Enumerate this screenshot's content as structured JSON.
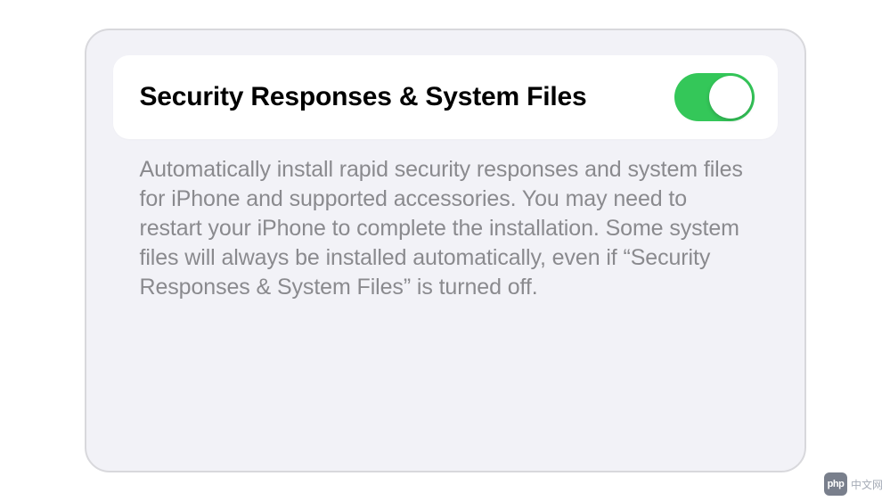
{
  "setting": {
    "title": "Security Responses & System Files",
    "toggle_on": true,
    "description": "Automatically install rapid security responses and system files for iPhone and supported accessories. You may need to restart your iPhone to complete the installation. Some system files will always be installed automatically, even if “Security Responses & System Files” is turned off."
  },
  "watermark": {
    "icon_text": "php",
    "label": "中文网"
  },
  "colors": {
    "toggle_on": "#34c759",
    "panel_bg": "#f2f2f7",
    "border": "#d8d8dc",
    "description_text": "#8a8a8e"
  }
}
